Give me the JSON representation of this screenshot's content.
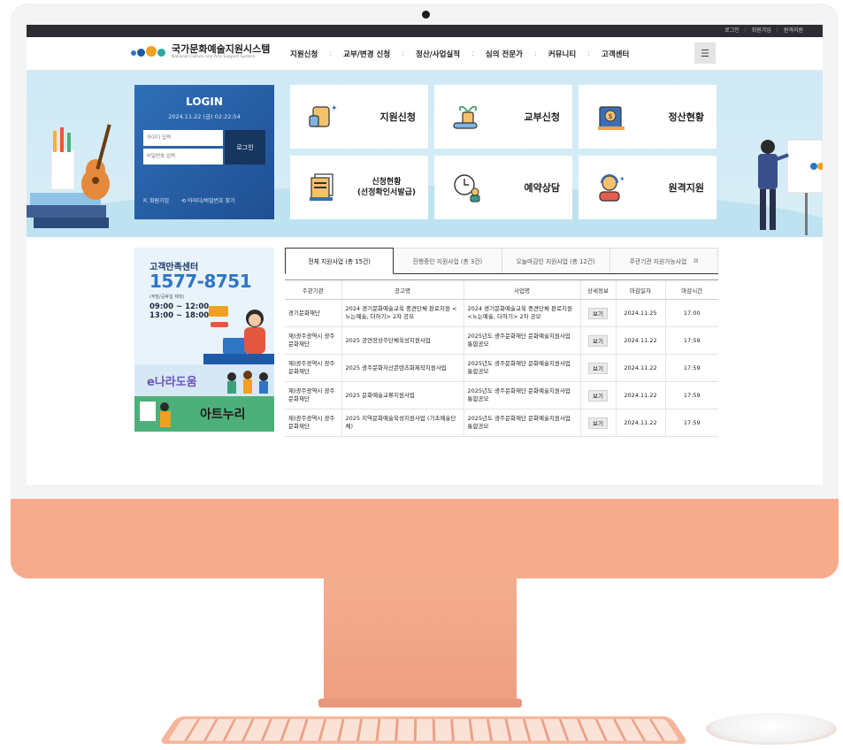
{
  "util_links": [
    "로그인",
    "회원가입",
    "원격지원"
  ],
  "logo": {
    "title": "국가문화예술지원시스템",
    "subtitle": "National Culture and Arts Support System"
  },
  "menu": [
    "지원신청",
    "교부/변경 신청",
    "정산/사업실적",
    "심의 전문가",
    "커뮤니티",
    "고객센터"
  ],
  "login": {
    "title": "LOGIN",
    "datetime": "2024.11.22 (금) 02:22:54",
    "id_placeholder": "아이디 입력",
    "pw_placeholder": "비밀번호 입력",
    "button": "로그인",
    "signup": "회원가입",
    "find": "아이디/비밀번호 찾기"
  },
  "tiles": [
    {
      "label": "지원신청"
    },
    {
      "label": "교부신청"
    },
    {
      "label": "정산현황"
    },
    {
      "label_line1": "신청현황",
      "label_line2": "(선정확인서발급)"
    },
    {
      "label": "예약상담"
    },
    {
      "label": "원격지원"
    }
  ],
  "customer_center": {
    "title": "고객만족센터",
    "phone": "1577-8751",
    "note": "(주말/공휴일 제외)",
    "hours1": "09:00 ~ 12:00",
    "hours2": "13:00 ~ 18:00"
  },
  "banners": {
    "enara": "e나라도움",
    "artnuri": "아트누리"
  },
  "tabs": [
    "전체 지원사업 (총 15건)",
    "진행중인 지원사업 (총 3건)",
    "오늘마감인 지원사업 (총 12건)",
    "주관기관 지원가능사업"
  ],
  "table": {
    "headers": [
      "주관기관",
      "공고명",
      "사업명",
      "상세정보",
      "마감일자",
      "마감시간"
    ],
    "rows": [
      {
        "org": "경기문화재단",
        "notice": "2024 경기문화예술교육 중견단체 판로지원 <노는예술, 더하기> 2차 공모",
        "project": "2024 경기문화예술교육 중견단체 판로지원 <노는예술, 더하기> 2차 공모",
        "detail": "보기",
        "date": "2024.11.25",
        "time": "17:00"
      },
      {
        "org": "재)광주광역시 광주문화재단",
        "notice": "2025 공연장상주단체육성지원사업",
        "project": "2025년도 광주문화재단 문화예술지원사업 통합공모",
        "detail": "보기",
        "date": "2024.11.22",
        "time": "17:59"
      },
      {
        "org": "재)광주광역시 광주문화재단",
        "notice": "2025 광주문화자산콘텐츠화제작지원사업",
        "project": "2025년도 광주문화재단 문화예술지원사업 통합공모",
        "detail": "보기",
        "date": "2024.11.22",
        "time": "17:59"
      },
      {
        "org": "재)광주광역시 광주문화재단",
        "notice": "2025 문화예술교류지원사업",
        "project": "2025년도 광주문화재단 문화예술지원사업 통합공모",
        "detail": "보기",
        "date": "2024.11.22",
        "time": "17:59"
      },
      {
        "org": "재)광주광역시 광주문화재단",
        "notice": "2025 지역문화예술육성지원사업 (기초예술단체)",
        "project": "2025년도 광주문화재단 문화예술지원사업 통합공모",
        "detail": "보기",
        "date": "2024.11.22",
        "time": "17:59"
      }
    ]
  },
  "colors": {
    "accent": "#2f75c4",
    "login_bg": "#1f4f93",
    "monitor": "#f3a98a",
    "hero_bg": "#cfe9f6"
  }
}
